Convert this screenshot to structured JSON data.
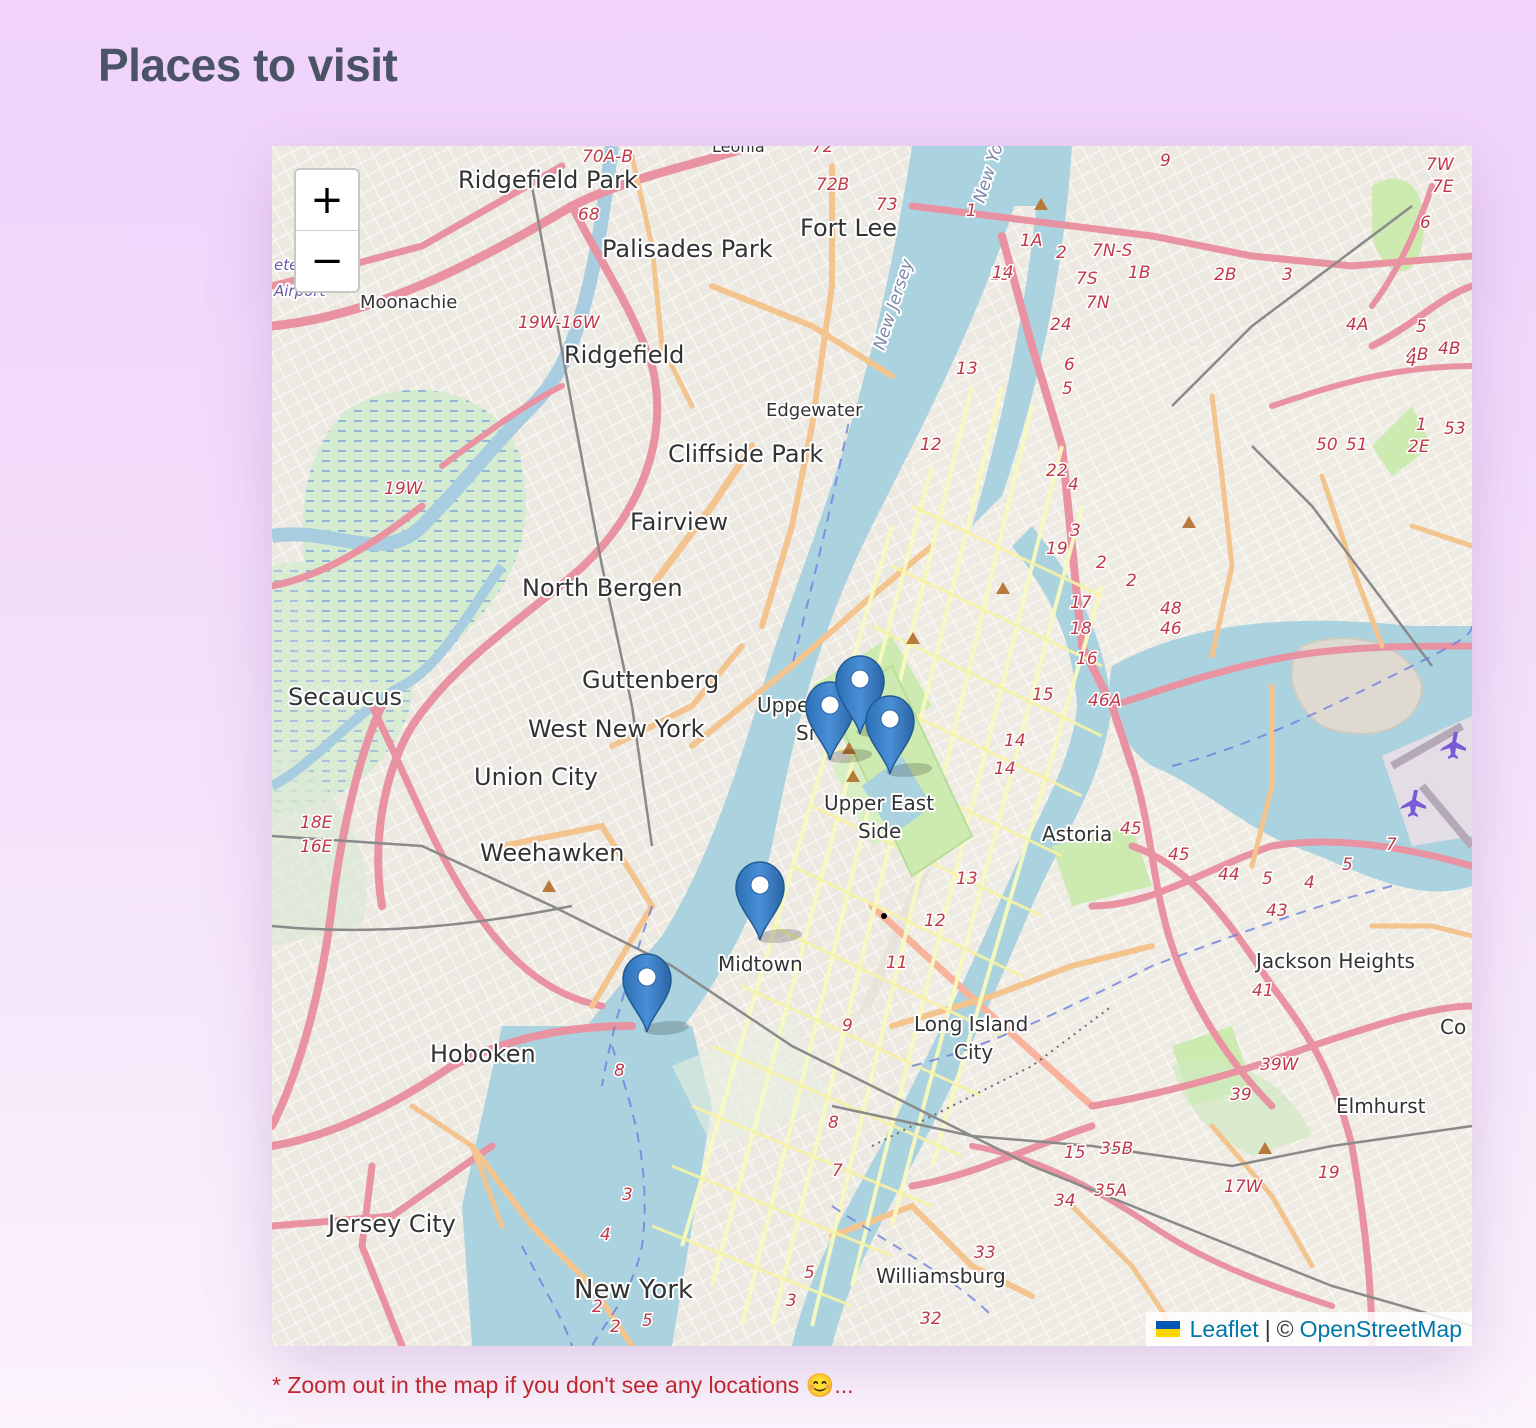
{
  "page": {
    "title": "Places to visit",
    "note": "* Zoom out in the map if you don't see any locations 😊..."
  },
  "map": {
    "zoom_in_label": "+",
    "zoom_out_label": "−",
    "attribution": {
      "leaflet": "Leaflet",
      "separator": "|",
      "copyright": "©",
      "osm": "OpenStreetMap"
    },
    "place_labels": [
      {
        "id": "ridgefield-park",
        "text": "Ridgefield Park"
      },
      {
        "id": "fort-lee",
        "text": "Fort Lee"
      },
      {
        "id": "palisades-park",
        "text": "Palisades Park"
      },
      {
        "id": "moonachie",
        "text": "Moonachie"
      },
      {
        "id": "ridgefield",
        "text": "Ridgefield"
      },
      {
        "id": "edgewater",
        "text": "Edgewater"
      },
      {
        "id": "cliffside-park",
        "text": "Cliffside Park"
      },
      {
        "id": "fairview",
        "text": "Fairview"
      },
      {
        "id": "north-bergen",
        "text": "North Bergen"
      },
      {
        "id": "guttenberg",
        "text": "Guttenberg"
      },
      {
        "id": "secaucus",
        "text": "Secaucus"
      },
      {
        "id": "west-new-york",
        "text": "West New York"
      },
      {
        "id": "union-city",
        "text": "Union City"
      },
      {
        "id": "weehawken",
        "text": "Weehawken"
      },
      {
        "id": "upper-west",
        "text": "Upper"
      },
      {
        "id": "upper-west-2",
        "text": "Si"
      },
      {
        "id": "upper-east-1",
        "text": "Upper East"
      },
      {
        "id": "upper-east-2",
        "text": "Side"
      },
      {
        "id": "astoria",
        "text": "Astoria"
      },
      {
        "id": "midtown",
        "text": "Midtown"
      },
      {
        "id": "hoboken",
        "text": "Hoboken"
      },
      {
        "id": "long-island-1",
        "text": "Long Island"
      },
      {
        "id": "long-island-2",
        "text": "City"
      },
      {
        "id": "jackson-heights",
        "text": "Jackson Heights"
      },
      {
        "id": "elmhurst",
        "text": "Elmhurst"
      },
      {
        "id": "jersey-city",
        "text": "Jersey City"
      },
      {
        "id": "new-york",
        "text": "New York"
      },
      {
        "id": "williamsburg",
        "text": "Williamsburg"
      },
      {
        "id": "new-jersey",
        "text": "New Jersey"
      },
      {
        "id": "new-york-river",
        "text": "New Yo"
      },
      {
        "id": "airport",
        "text": "Airport"
      },
      {
        "id": "teterboro",
        "text": "ete"
      },
      {
        "id": "leonia",
        "text": "Leonia"
      },
      {
        "id": "corona",
        "text": "Co"
      }
    ],
    "route_numbers": [
      "70A-B",
      "72",
      "72B",
      "73",
      "68",
      "9",
      "7W",
      "7E",
      "6",
      "1",
      "1A",
      "2",
      "7N-S",
      "1B",
      "2B",
      "3",
      "15",
      "14",
      "7S",
      "7N",
      "4A",
      "5",
      "4B",
      "4",
      "4B",
      "19W-16W",
      "24",
      "13",
      "6",
      "5",
      "12",
      "1",
      "53",
      "50",
      "51",
      "2E",
      "22",
      "4",
      "19W",
      "3",
      "19",
      "2",
      "2",
      "48",
      "46",
      "17",
      "18",
      "16",
      "15",
      "46A",
      "14",
      "14",
      "45",
      "45",
      "44",
      "5",
      "4",
      "5",
      "7",
      "43",
      "13",
      "12",
      "11",
      "41",
      "39W",
      "39",
      "15",
      "35A",
      "35B",
      "8",
      "9",
      "8",
      "7",
      "34",
      "33",
      "32",
      "5",
      "3",
      "4",
      "3",
      "2",
      "2",
      "5",
      "18E",
      "16E",
      "17W",
      "19"
    ],
    "markers": [
      {
        "name": "marker-upper-west-1"
      },
      {
        "name": "marker-central-park-north"
      },
      {
        "name": "marker-central-park-east"
      },
      {
        "name": "marker-midtown"
      },
      {
        "name": "marker-hudson-yards"
      }
    ]
  }
}
